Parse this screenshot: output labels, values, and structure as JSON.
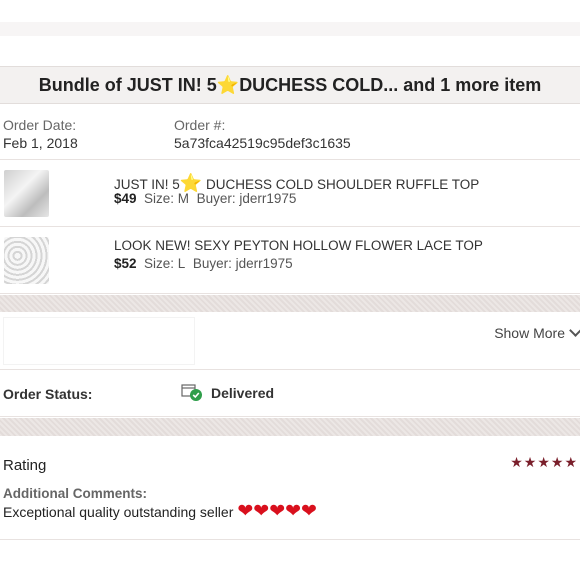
{
  "header": {
    "title_prefix": "Bundle of JUST IN! 5",
    "title_star": "⭐",
    "title_suffix": " DUCHESS COLD... and 1 more item"
  },
  "order": {
    "date_label": "Order Date:",
    "date_value": "Feb 1, 2018",
    "number_label": "Order #:",
    "number_value": "5a73fca42519c95def3c1635"
  },
  "items": [
    {
      "title_prefix": "JUST IN! 5",
      "title_star": "⭐",
      "title_suffix": " DUCHESS COLD SHOULDER RUFFLE TOP",
      "price": "$49",
      "size": "Size: M",
      "buyer": "Buyer: jderr1975"
    },
    {
      "title": "LOOK NEW! SEXY PEYTON HOLLOW FLOWER LACE TOP",
      "price": "$52",
      "size": "Size: L",
      "buyer": "Buyer: jderr1975"
    }
  ],
  "show_more": {
    "label": "Show More",
    "icon": "chevron-down-icon"
  },
  "status": {
    "label": "Order Status:",
    "value": "Delivered",
    "icon": "delivered-box-check-icon"
  },
  "rating": {
    "label": "Rating",
    "stars": "★★★★★",
    "stars_value": 5,
    "comments_label": "Additional Comments:",
    "comments_text": "Exceptional quality outstanding seller",
    "hearts": "❤❤❤❤❤"
  },
  "colors": {
    "star": "#7a1f2b",
    "heart": "#d9101d",
    "status_check": "#2e9e4a"
  }
}
